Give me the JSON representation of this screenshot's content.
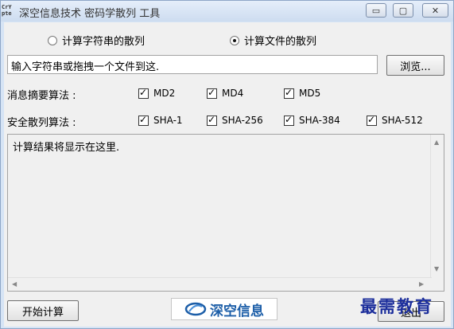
{
  "window": {
    "app_icon_lines": [
      "CrY",
      "pte"
    ],
    "title": "深空信息技术 密码学散列 工具",
    "controls": [
      "minimize",
      "maximize",
      "close"
    ]
  },
  "mode": {
    "option_string": "计算字符串的散列",
    "option_file": "计算文件的散列",
    "selected": "file"
  },
  "input": {
    "value": "输入字符串或拖拽一个文件到这.",
    "browse_label": "浏览..."
  },
  "digest": {
    "label": "消息摘要算法 :",
    "algorithms": [
      {
        "name": "MD2",
        "checked": true
      },
      {
        "name": "MD4",
        "checked": true
      },
      {
        "name": "MD5",
        "checked": true
      }
    ]
  },
  "sha": {
    "label": "安全散列算法 :",
    "algorithms": [
      {
        "name": "SHA-1",
        "checked": true
      },
      {
        "name": "SHA-256",
        "checked": true
      },
      {
        "name": "SHA-384",
        "checked": true
      },
      {
        "name": "SHA-512",
        "checked": true
      }
    ]
  },
  "result": {
    "text": "计算结果将显示在这里."
  },
  "footer": {
    "start_label": "开始计算",
    "logo_text": "深空信息",
    "exit_label": "退出"
  },
  "watermark": {
    "text": "最需教育"
  },
  "colors": {
    "titlebar": "#cddcf0",
    "logo_blue": "#1c5ea8",
    "watermark_blue": "#1d2f9c"
  }
}
